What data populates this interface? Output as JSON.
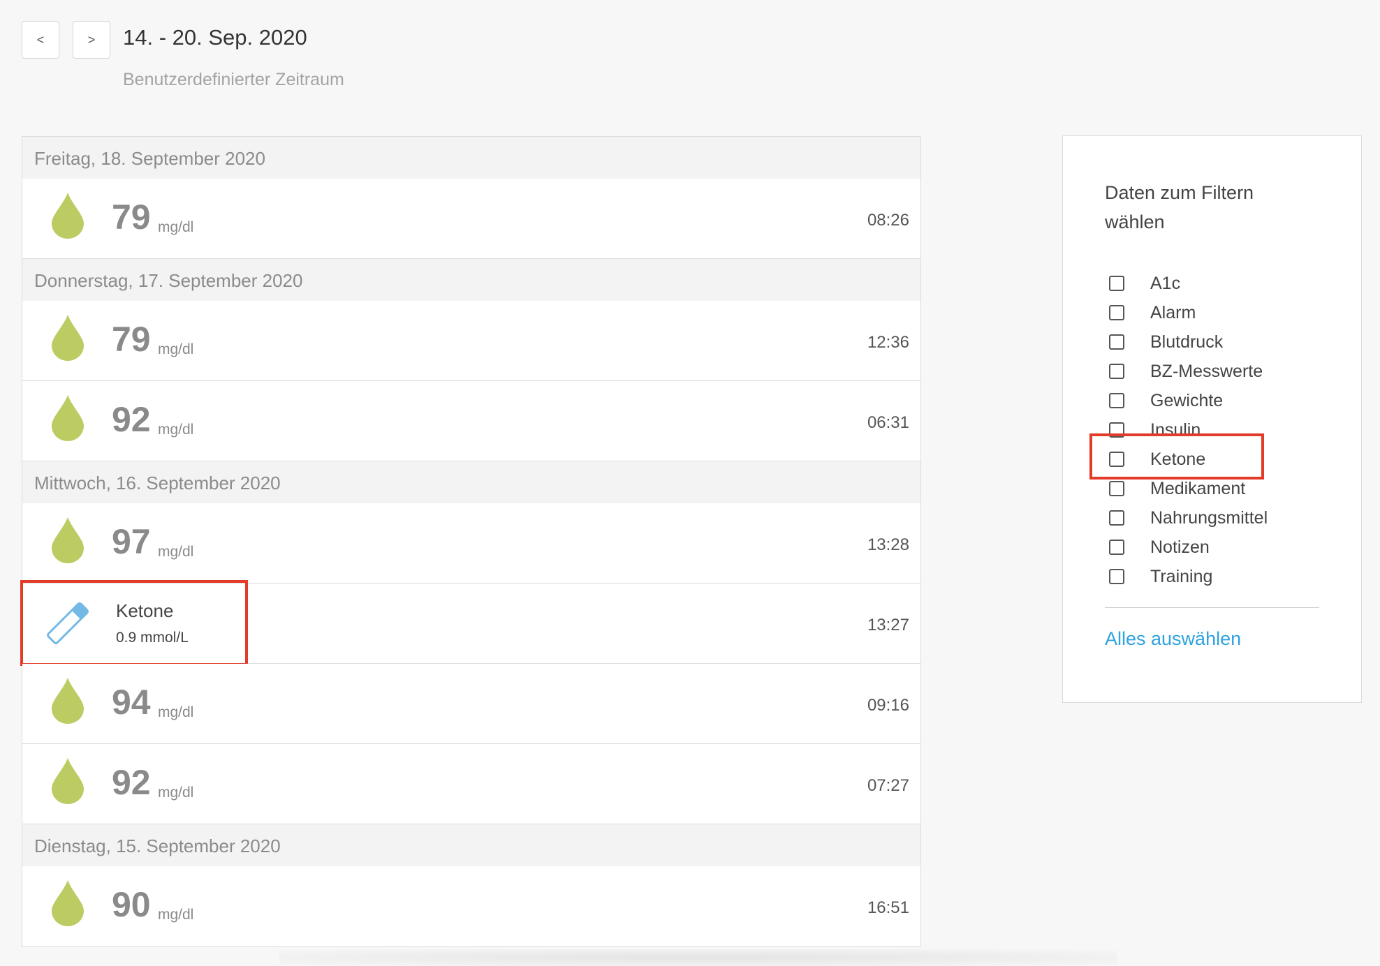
{
  "header": {
    "prev_label": "<",
    "next_label": ">",
    "period_title": "14. - 20. Sep. 2020",
    "period_subtitle": "Benutzerdefinierter Zeitraum"
  },
  "colors": {
    "drop": "#bccb62",
    "ketone_strip": "#74b9e6",
    "highlight": "#e23b2a",
    "link": "#2ea3df"
  },
  "log": {
    "days": [
      {
        "date": "Freitag, 18. September 2020",
        "entries": [
          {
            "type": "bg",
            "icon": "drop-icon",
            "value": "79",
            "unit": "mg/dl",
            "time": "08:26"
          }
        ]
      },
      {
        "date": "Donnerstag, 17. September 2020",
        "entries": [
          {
            "type": "bg",
            "icon": "drop-icon",
            "value": "79",
            "unit": "mg/dl",
            "time": "12:36"
          },
          {
            "type": "bg",
            "icon": "drop-icon",
            "value": "92",
            "unit": "mg/dl",
            "time": "06:31"
          }
        ]
      },
      {
        "date": "Mittwoch, 16. September 2020",
        "entries": [
          {
            "type": "bg",
            "icon": "drop-icon",
            "value": "97",
            "unit": "mg/dl",
            "time": "13:28"
          },
          {
            "type": "ketone",
            "icon": "ketone-strip-icon",
            "title": "Ketone",
            "value": "0.9 mmol/L",
            "time": "13:27"
          },
          {
            "type": "bg",
            "icon": "drop-icon",
            "value": "94",
            "unit": "mg/dl",
            "time": "09:16"
          },
          {
            "type": "bg",
            "icon": "drop-icon",
            "value": "92",
            "unit": "mg/dl",
            "time": "07:27"
          }
        ]
      },
      {
        "date": "Dienstag, 15. September 2020",
        "entries": [
          {
            "type": "bg",
            "icon": "drop-icon",
            "value": "90",
            "unit": "mg/dl",
            "time": "16:51"
          }
        ]
      }
    ]
  },
  "filter": {
    "heading": "Daten zum Filtern wählen",
    "options": [
      {
        "label": "A1c",
        "checked": false
      },
      {
        "label": "Alarm",
        "checked": false
      },
      {
        "label": "Blutdruck",
        "checked": false
      },
      {
        "label": "BZ-Messwerte",
        "checked": false
      },
      {
        "label": "Gewichte",
        "checked": false
      },
      {
        "label": "Insulin",
        "checked": false
      },
      {
        "label": "Ketone",
        "checked": false
      },
      {
        "label": "Medikament",
        "checked": false
      },
      {
        "label": "Nahrungsmittel",
        "checked": false
      },
      {
        "label": "Notizen",
        "checked": false
      },
      {
        "label": "Training",
        "checked": false
      }
    ],
    "select_all_label": "Alles auswählen"
  }
}
